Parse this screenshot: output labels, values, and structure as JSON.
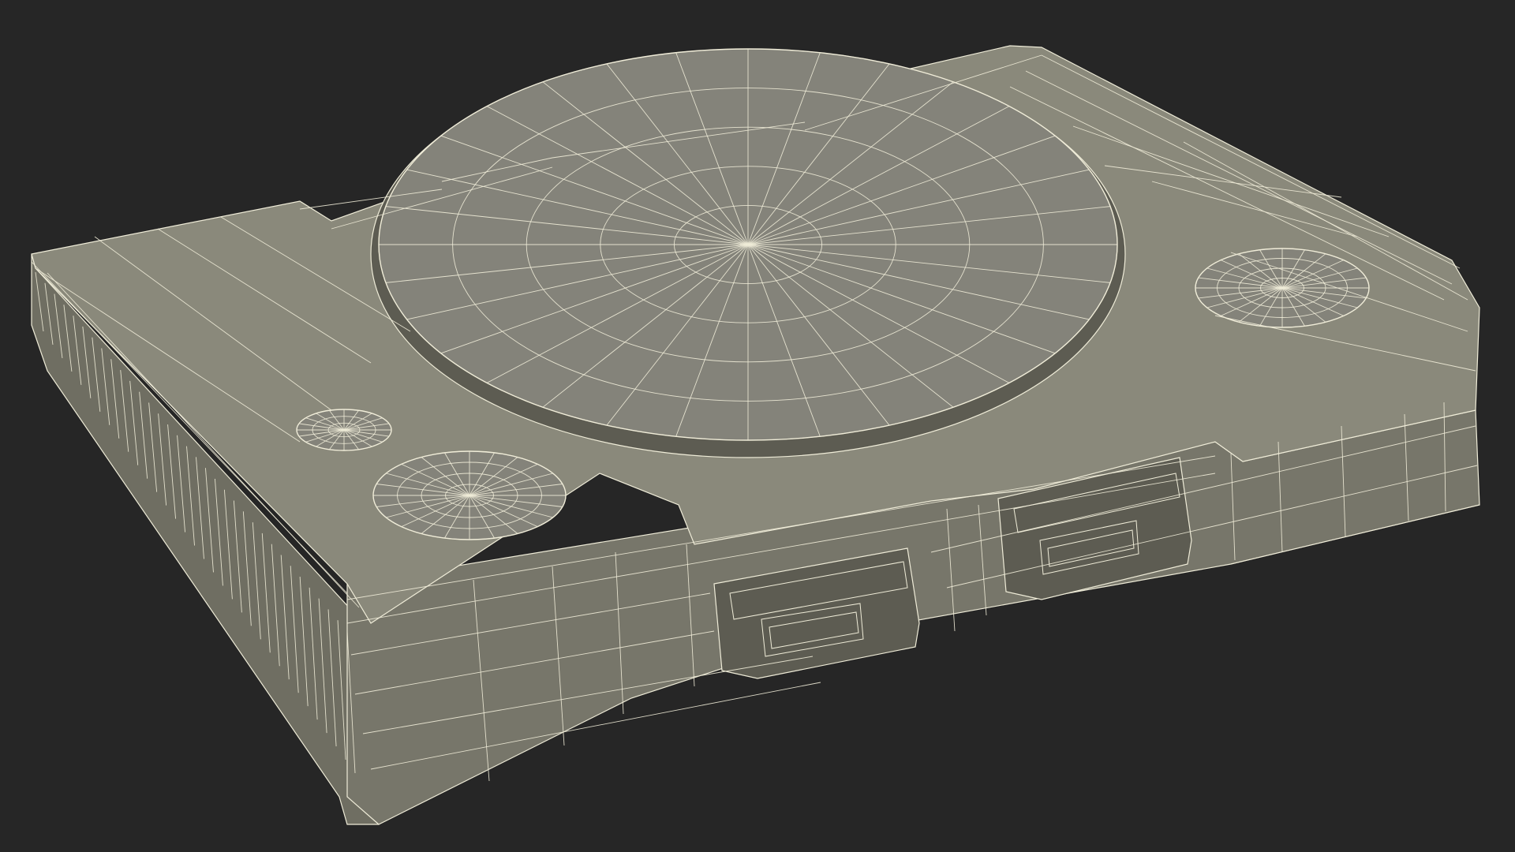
{
  "scene": {
    "subject": "",
    "colors": {
      "background": "#262626",
      "body_fill": "#7c7b6d",
      "top_fill": "#8a897b",
      "side_fill": "#6f6e62",
      "front_fill": "#77766a",
      "lid_fill": "#84837a",
      "wire": "#efecd8",
      "shadow": "#5d5c52"
    }
  }
}
